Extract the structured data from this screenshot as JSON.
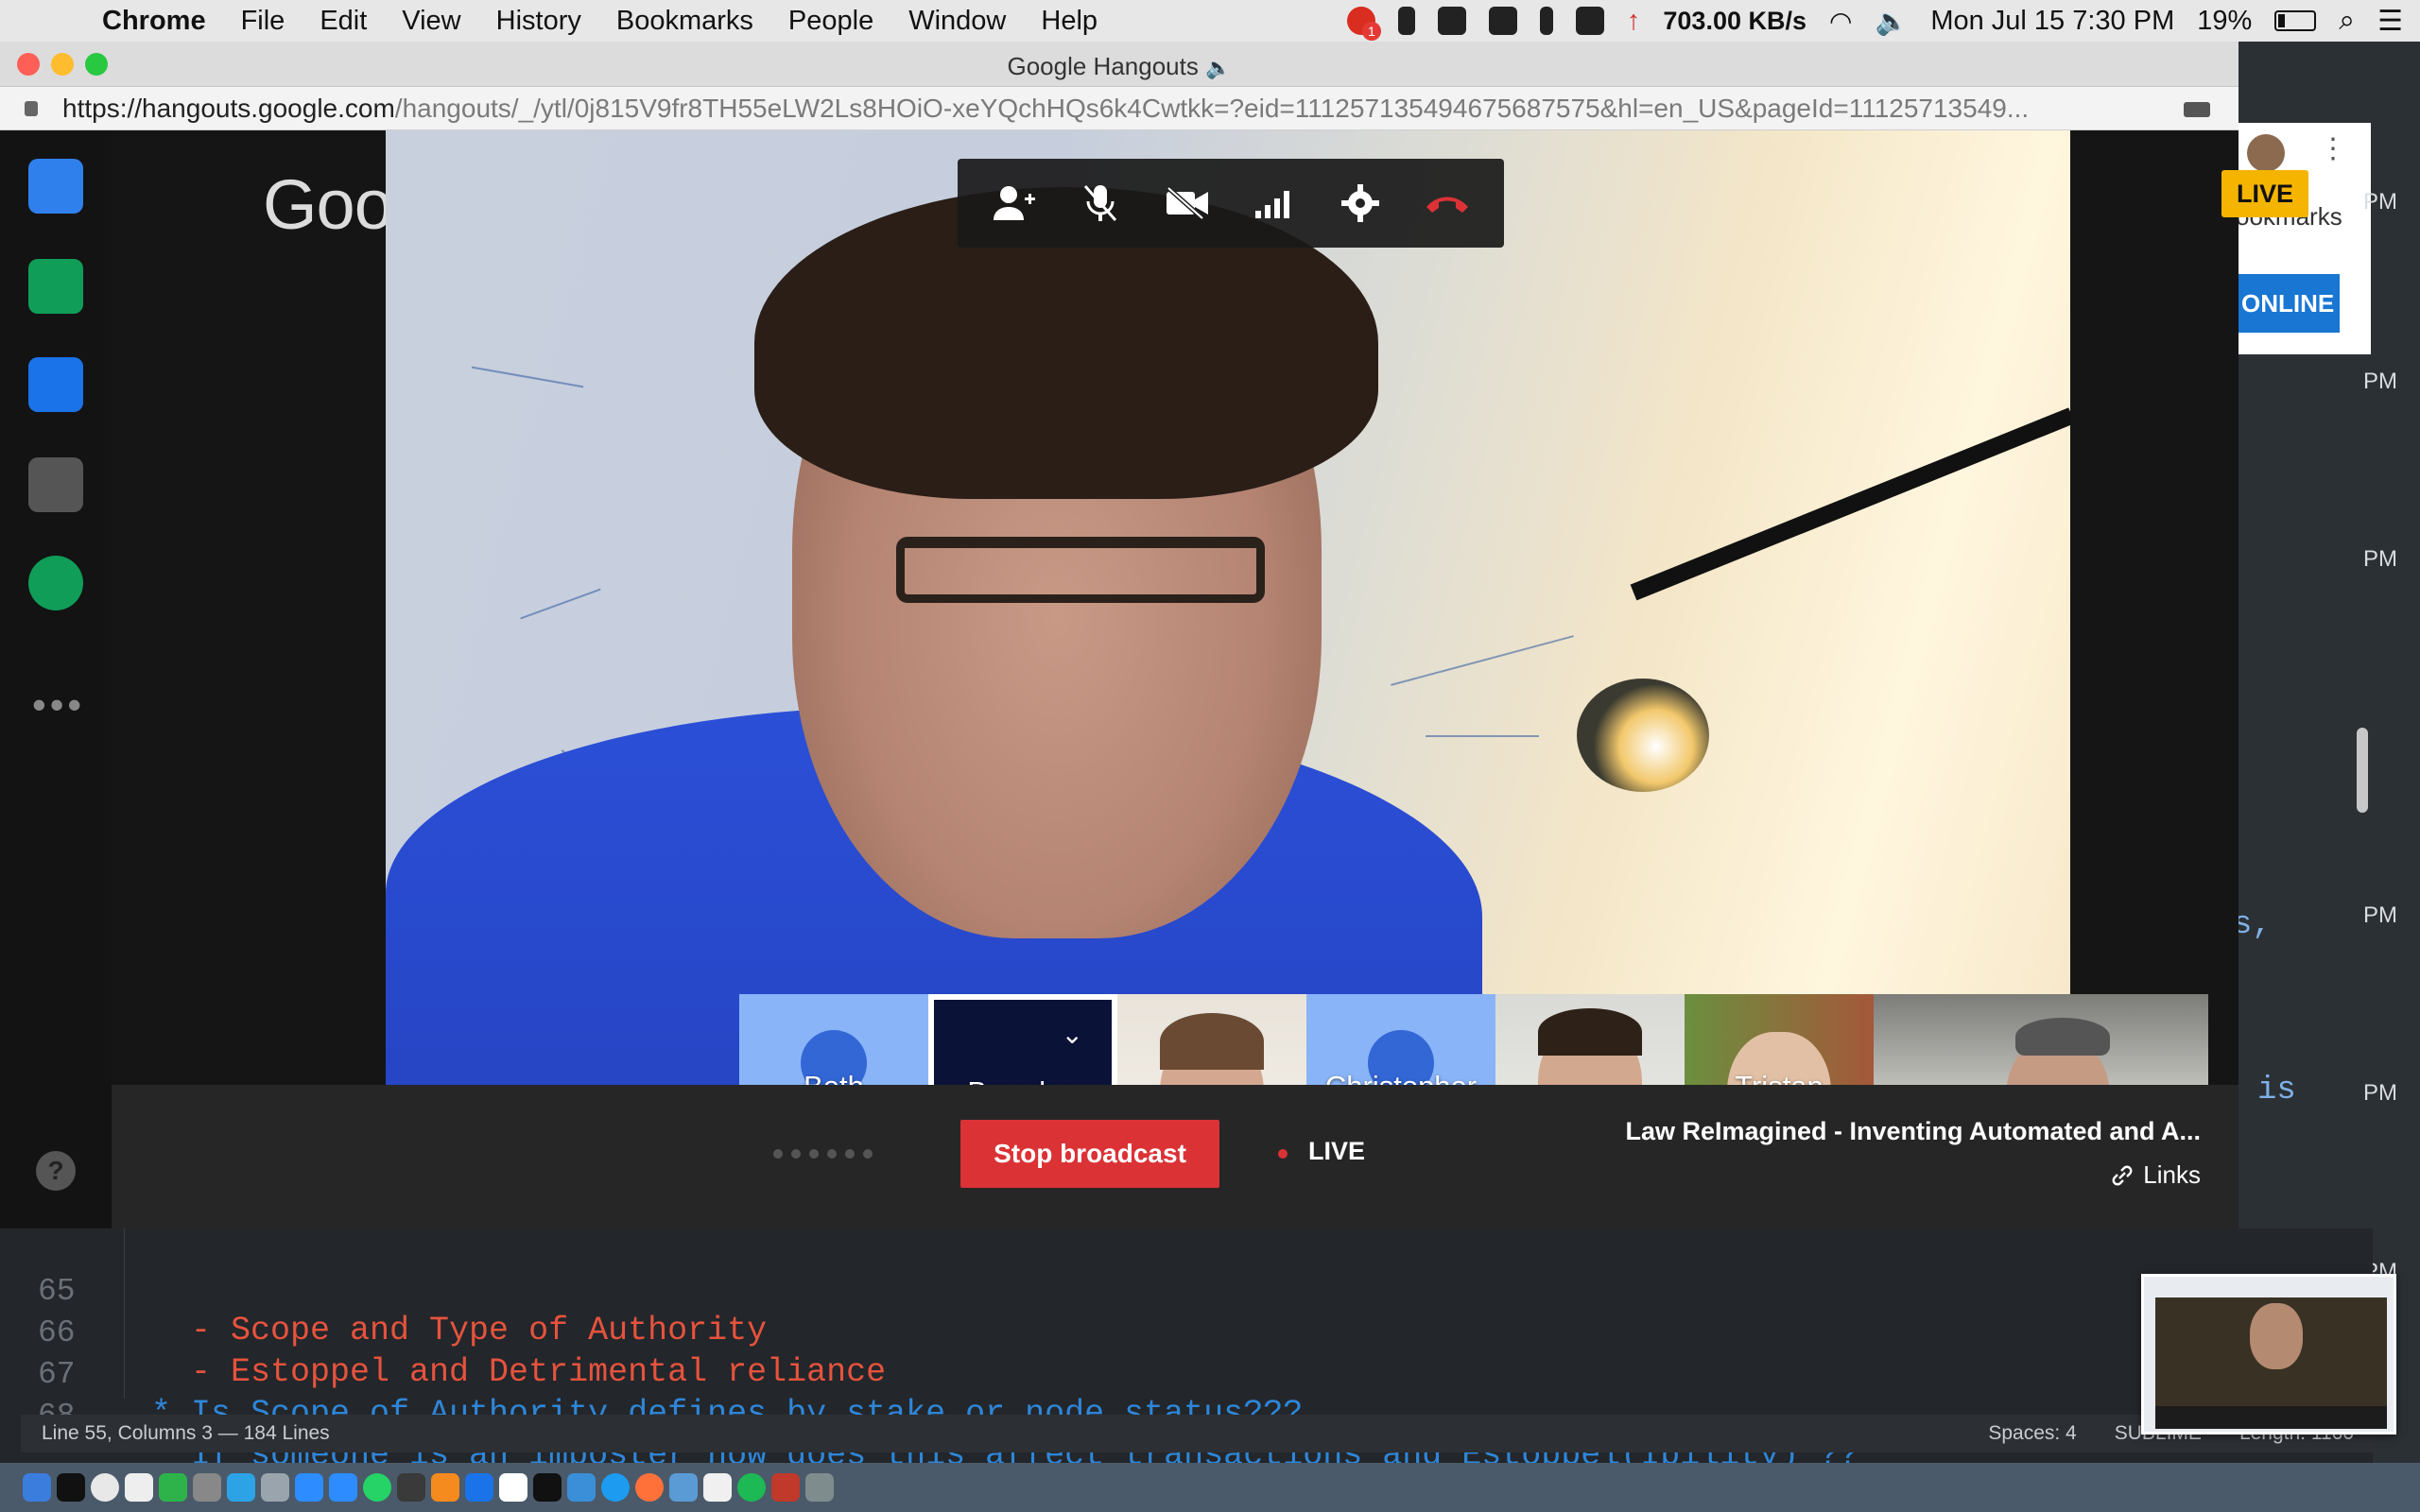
{
  "menubar": {
    "app": "Chrome",
    "items": [
      "File",
      "Edit",
      "View",
      "History",
      "Bookmarks",
      "People",
      "Window",
      "Help"
    ],
    "network_speed": "703.00 KB/s",
    "clock": "Mon Jul 15  7:30 PM",
    "battery": "19%",
    "notification_count": "1"
  },
  "window": {
    "title": "Google Hangouts",
    "url_host": "https://hangouts.google.com",
    "url_path": "/hangouts/_/ytl/0j815V9fr8TH55eLW2Ls8HOiO-xeYQchHQs6k4Cwtkk=?eid=111257135494675687575&hl=en_US&pageId=11125713549..."
  },
  "hangout": {
    "brand": "Google",
    "live_badge": "LIVE",
    "controls": [
      "add-person-icon",
      "mic-off-icon",
      "camera-off-icon",
      "signal-icon",
      "settings-icon",
      "hang-up-icon"
    ],
    "participants": [
      {
        "name": "Beth",
        "muted": true,
        "avatar": true
      },
      {
        "name": "Brenden",
        "muted": false,
        "selected": true
      },
      {
        "name": "",
        "muted": true,
        "video": true
      },
      {
        "name": "Christopher",
        "muted": true,
        "avatar": true
      },
      {
        "name": "",
        "muted": false,
        "video": true
      },
      {
        "name": "Tristan",
        "muted": true,
        "video": true
      },
      {
        "name": "",
        "muted": false,
        "video": true
      }
    ],
    "stop_broadcast": "Stop broadcast",
    "live_label": "LIVE",
    "event_title": "Law ReImagined - Inventing Automated and A...",
    "links_label": "Links"
  },
  "background": {
    "bookmarks_fragment": "ookmarks",
    "online_button": "ONLINE",
    "pm_labels": [
      "PM",
      "PM",
      "PM",
      "PM",
      "PM",
      "PM",
      "PM"
    ],
    "overflow_text_1": "s,",
    "overflow_text_2": "is"
  },
  "editor": {
    "lines": [
      {
        "num": "65",
        "text": "  - Scope and Type of Authority",
        "color": "red"
      },
      {
        "num": "66",
        "text": "  - Estoppel and Detrimental reliance",
        "color": "red"
      },
      {
        "num": "67",
        "text": "* Is Scope of Authority defines by stake or node status???",
        "color": "blue"
      },
      {
        "num": "68",
        "text": "* If someone is an imposter how does this affect transactions and Estoppel(Ibility) ??",
        "color": "blue"
      }
    ],
    "status_left": "Line 55, Columns 3 — 184 Lines",
    "status_spaces": "Spaces: 4",
    "status_syntax": "SUBLIME",
    "status_length": "Length: 1160"
  }
}
